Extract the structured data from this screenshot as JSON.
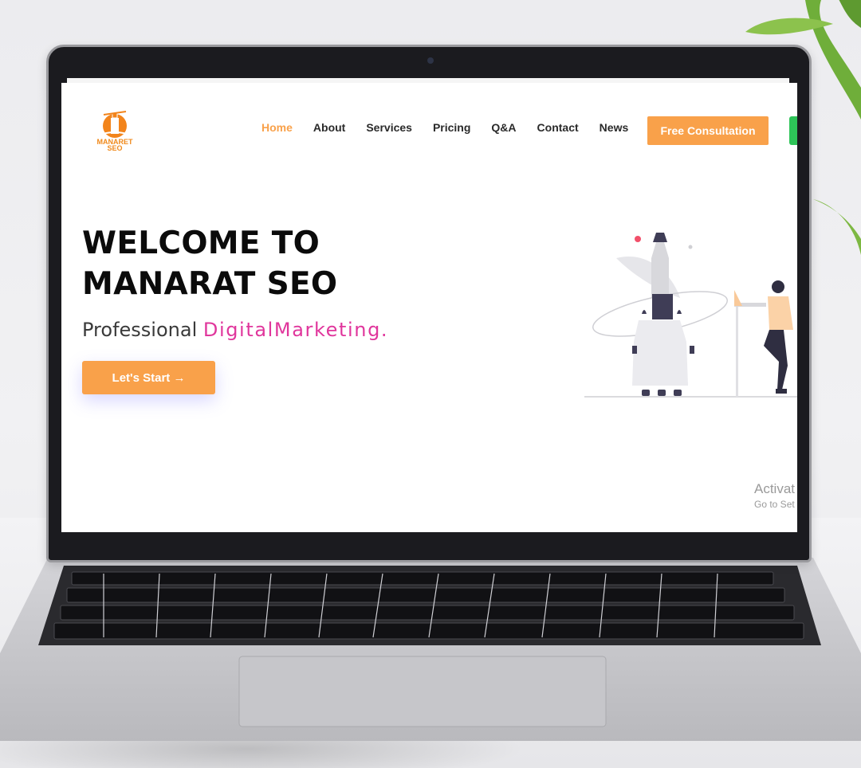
{
  "nav": {
    "items": [
      {
        "label": "Home",
        "active": true
      },
      {
        "label": "About",
        "active": false
      },
      {
        "label": "Services",
        "active": false
      },
      {
        "label": "Pricing",
        "active": false
      },
      {
        "label": "Q&A",
        "active": false
      },
      {
        "label": "Contact",
        "active": false
      },
      {
        "label": "News",
        "active": false
      }
    ],
    "cta_label": "Free Consultation"
  },
  "brand": {
    "logo_text_line1": "MANARET",
    "logo_text_line2": "SEO"
  },
  "hero": {
    "title_line1": "WELCOME TO",
    "title_line2": "MANARAT SEO",
    "subtitle_prefix": "Professional",
    "subtitle_accent": "DigitalMarketing.",
    "start_label": "Let's Start →"
  },
  "watermark": {
    "line1": "Activat",
    "line2": "Go to Set"
  },
  "colors": {
    "accent_orange": "#f9a14a",
    "accent_pink": "#e0369c",
    "green": "#2ec458"
  }
}
